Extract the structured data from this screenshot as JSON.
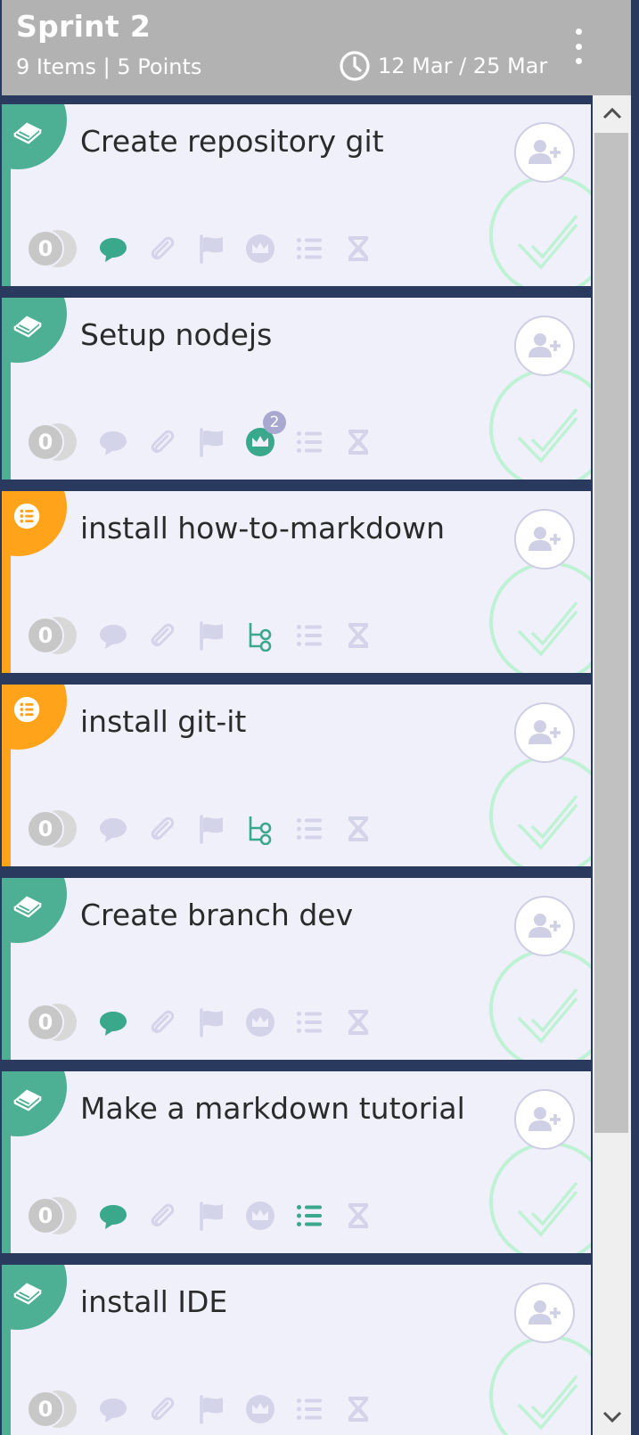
{
  "sprint": {
    "title": "Sprint 2",
    "summary": "9 Items | 5 Points",
    "dates": "12 Mar / 25 Mar"
  },
  "colors": {
    "story": "#4daf93",
    "task": "#ffa31a",
    "active": "#3aa88a",
    "inactive": "#d3d3ea",
    "done_check": "#bff2d4",
    "header_bg": "#b2b2b2",
    "separator": "#2a3a5e"
  },
  "cards": [
    {
      "type": "story",
      "title": "Create repository git",
      "points": "0",
      "comments_active": true,
      "structure_icon": "crown",
      "structure_active": false,
      "structure_count": "",
      "checklist_active": false
    },
    {
      "type": "story",
      "title": "Setup nodejs",
      "points": "0",
      "comments_active": false,
      "structure_icon": "crown",
      "structure_active": true,
      "structure_count": "2",
      "checklist_active": false
    },
    {
      "type": "task",
      "title": "install how-to-markdown",
      "points": "0",
      "comments_active": false,
      "structure_icon": "tree",
      "structure_active": true,
      "structure_count": "",
      "checklist_active": false
    },
    {
      "type": "task",
      "title": "install git-it",
      "points": "0",
      "comments_active": false,
      "structure_icon": "tree",
      "structure_active": true,
      "structure_count": "",
      "checklist_active": false
    },
    {
      "type": "story",
      "title": "Create branch dev",
      "points": "0",
      "comments_active": true,
      "structure_icon": "crown",
      "structure_active": false,
      "structure_count": "",
      "checklist_active": false
    },
    {
      "type": "story",
      "title": "Make a markdown tutorial",
      "points": "0",
      "comments_active": true,
      "structure_icon": "crown",
      "structure_active": false,
      "structure_count": "",
      "checklist_active": true
    },
    {
      "type": "story",
      "title": "install IDE",
      "points": "0",
      "comments_active": false,
      "structure_icon": "crown",
      "structure_active": false,
      "structure_count": "",
      "checklist_active": false
    }
  ],
  "icons": {
    "header": [
      "clock-icon",
      "more-vertical-icon"
    ],
    "card": [
      "story-book-icon",
      "task-list-icon",
      "add-user-icon",
      "done-check-icon",
      "comment-icon",
      "attachment-icon",
      "flag-icon",
      "crown-icon",
      "subtask-tree-icon",
      "checklist-icon",
      "hourglass-icon"
    ],
    "scrollbar": [
      "chevron-up-icon",
      "chevron-down-icon"
    ]
  }
}
